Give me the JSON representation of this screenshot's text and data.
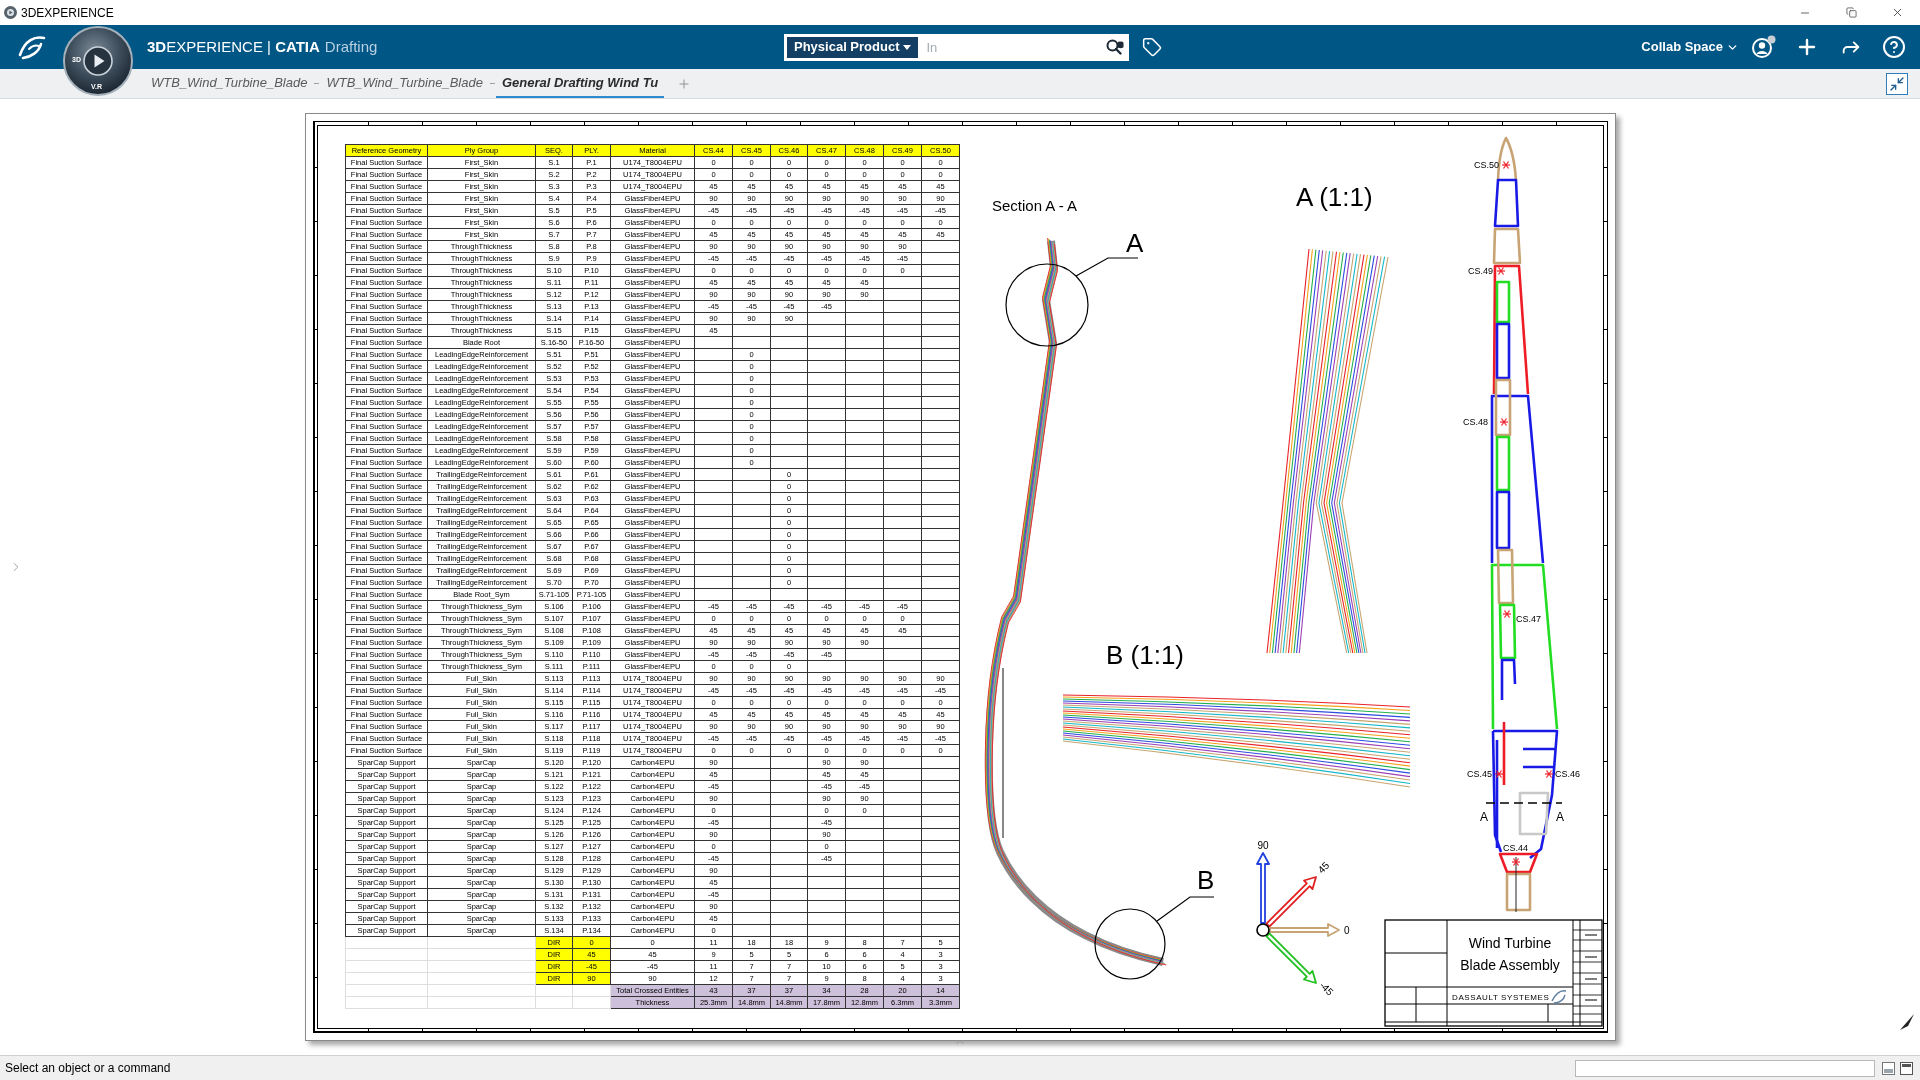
{
  "title_bar": {
    "title": "3DEXPERIENCE"
  },
  "top_bar": {
    "brand": "**3D**EXPERIENCE | **CATIA**",
    "module": "Drafting",
    "compass_labels": [
      "3D",
      "V.R"
    ],
    "search": {
      "scope": "Physical Product",
      "placeholder": "In"
    },
    "space": "Collab Space"
  },
  "tabs": [
    {
      "label": "WTB_Wind_Turbine_Blade",
      "selected": false
    },
    {
      "label": "WTB_Wind_Turbine_Blade",
      "selected": false
    },
    {
      "label": "General Drafting Wind Tu",
      "selected": true
    }
  ],
  "sheet": {
    "table": {
      "columns": [
        "Reference Geometry",
        "Ply Group",
        "SEQ.",
        "PLY.",
        "Material",
        "CS.44",
        "CS.45",
        "CS.46",
        "CS.47",
        "CS.48",
        "CS.49",
        "CS.50"
      ],
      "rows": [
        [
          "Final Suction Surface",
          "First_Skin",
          "S.1",
          "P.1",
          "U174_T8004EPU",
          "0",
          "0",
          "0",
          "0",
          "0",
          "0",
          "0"
        ],
        [
          "Final Suction Surface",
          "First_Skin",
          "S.2",
          "P.2",
          "U174_T8004EPU",
          "0",
          "0",
          "0",
          "0",
          "0",
          "0",
          "0"
        ],
        [
          "Final Suction Surface",
          "First_Skin",
          "S.3",
          "P.3",
          "U174_T8004EPU",
          "45",
          "45",
          "45",
          "45",
          "45",
          "45",
          "45"
        ],
        [
          "Final Suction Surface",
          "First_Skin",
          "S.4",
          "P.4",
          "GlassFiber4EPU",
          "90",
          "90",
          "90",
          "90",
          "90",
          "90",
          "90"
        ],
        [
          "Final Suction Surface",
          "First_Skin",
          "S.5",
          "P.5",
          "GlassFiber4EPU",
          "-45",
          "-45",
          "-45",
          "-45",
          "-45",
          "-45",
          "-45"
        ],
        [
          "Final Suction Surface",
          "First_Skin",
          "S.6",
          "P.6",
          "GlassFiber4EPU",
          "0",
          "0",
          "0",
          "0",
          "0",
          "0",
          "0"
        ],
        [
          "Final Suction Surface",
          "First_Skin",
          "S.7",
          "P.7",
          "GlassFiber4EPU",
          "45",
          "45",
          "45",
          "45",
          "45",
          "45",
          "45"
        ],
        [
          "Final Suction Surface",
          "ThroughThickness",
          "S.8",
          "P.8",
          "GlassFiber4EPU",
          "90",
          "90",
          "90",
          "90",
          "90",
          "90",
          null
        ],
        [
          "Final Suction Surface",
          "ThroughThickness",
          "S.9",
          "P.9",
          "GlassFiber4EPU",
          "-45",
          "-45",
          "-45",
          "-45",
          "-45",
          "-45",
          null
        ],
        [
          "Final Suction Surface",
          "ThroughThickness",
          "S.10",
          "P.10",
          "GlassFiber4EPU",
          "0",
          "0",
          "0",
          "0",
          "0",
          "0",
          null
        ],
        [
          "Final Suction Surface",
          "ThroughThickness",
          "S.11",
          "P.11",
          "GlassFiber4EPU",
          "45",
          "45",
          "45",
          "45",
          "45",
          null,
          null
        ],
        [
          "Final Suction Surface",
          "ThroughThickness",
          "S.12",
          "P.12",
          "GlassFiber4EPU",
          "90",
          "90",
          "90",
          "90",
          "90",
          null,
          null
        ],
        [
          "Final Suction Surface",
          "ThroughThickness",
          "S.13",
          "P.13",
          "GlassFiber4EPU",
          "-45",
          "-45",
          "-45",
          "-45",
          null,
          null,
          null
        ],
        [
          "Final Suction Surface",
          "ThroughThickness",
          "S.14",
          "P.14",
          "GlassFiber4EPU",
          "90",
          "90",
          "90",
          null,
          null,
          null,
          null
        ],
        [
          "Final Suction Surface",
          "ThroughThickness",
          "S.15",
          "P.15",
          "GlassFiber4EPU",
          "45",
          null,
          null,
          null,
          null,
          null,
          null
        ],
        [
          "Final Suction Surface",
          "Blade Root",
          "S.16-50",
          "P.16-50",
          "GlassFiber4EPU",
          null,
          null,
          null,
          null,
          null,
          null,
          null
        ],
        [
          "Final Suction Surface",
          "LeadingEdgeReinforcement",
          "S.51",
          "P.51",
          "GlassFiber4EPU",
          null,
          "0",
          null,
          null,
          null,
          null,
          null
        ],
        [
          "Final Suction Surface",
          "LeadingEdgeReinforcement",
          "S.52",
          "P.52",
          "GlassFiber4EPU",
          null,
          "0",
          null,
          null,
          null,
          null,
          null
        ],
        [
          "Final Suction Surface",
          "LeadingEdgeReinforcement",
          "S.53",
          "P.53",
          "GlassFiber4EPU",
          null,
          "0",
          null,
          null,
          null,
          null,
          null
        ],
        [
          "Final Suction Surface",
          "LeadingEdgeReinforcement",
          "S.54",
          "P.54",
          "GlassFiber4EPU",
          null,
          "0",
          null,
          null,
          null,
          null,
          null
        ],
        [
          "Final Suction Surface",
          "LeadingEdgeReinforcement",
          "S.55",
          "P.55",
          "GlassFiber4EPU",
          null,
          "0",
          null,
          null,
          null,
          null,
          null
        ],
        [
          "Final Suction Surface",
          "LeadingEdgeReinforcement",
          "S.56",
          "P.56",
          "GlassFiber4EPU",
          null,
          "0",
          null,
          null,
          null,
          null,
          null
        ],
        [
          "Final Suction Surface",
          "LeadingEdgeReinforcement",
          "S.57",
          "P.57",
          "GlassFiber4EPU",
          null,
          "0",
          null,
          null,
          null,
          null,
          null
        ],
        [
          "Final Suction Surface",
          "LeadingEdgeReinforcement",
          "S.58",
          "P.58",
          "GlassFiber4EPU",
          null,
          "0",
          null,
          null,
          null,
          null,
          null
        ],
        [
          "Final Suction Surface",
          "LeadingEdgeReinforcement",
          "S.59",
          "P.59",
          "GlassFiber4EPU",
          null,
          "0",
          null,
          null,
          null,
          null,
          null
        ],
        [
          "Final Suction Surface",
          "LeadingEdgeReinforcement",
          "S.60",
          "P.60",
          "GlassFiber4EPU",
          null,
          "0",
          null,
          null,
          null,
          null,
          null
        ],
        [
          "Final Suction Surface",
          "TrailingEdgeReinforcement",
          "S.61",
          "P.61",
          "GlassFiber4EPU",
          null,
          null,
          "0",
          null,
          null,
          null,
          null
        ],
        [
          "Final Suction Surface",
          "TrailingEdgeReinforcement",
          "S.62",
          "P.62",
          "GlassFiber4EPU",
          null,
          null,
          "0",
          null,
          null,
          null,
          null
        ],
        [
          "Final Suction Surface",
          "TrailingEdgeReinforcement",
          "S.63",
          "P.63",
          "GlassFiber4EPU",
          null,
          null,
          "0",
          null,
          null,
          null,
          null
        ],
        [
          "Final Suction Surface",
          "TrailingEdgeReinforcement",
          "S.64",
          "P.64",
          "GlassFiber4EPU",
          null,
          null,
          "0",
          null,
          null,
          null,
          null
        ],
        [
          "Final Suction Surface",
          "TrailingEdgeReinforcement",
          "S.65",
          "P.65",
          "GlassFiber4EPU",
          null,
          null,
          "0",
          null,
          null,
          null,
          null
        ],
        [
          "Final Suction Surface",
          "TrailingEdgeReinforcement",
          "S.66",
          "P.66",
          "GlassFiber4EPU",
          null,
          null,
          "0",
          null,
          null,
          null,
          null
        ],
        [
          "Final Suction Surface",
          "TrailingEdgeReinforcement",
          "S.67",
          "P.67",
          "GlassFiber4EPU",
          null,
          null,
          "0",
          null,
          null,
          null,
          null
        ],
        [
          "Final Suction Surface",
          "TrailingEdgeReinforcement",
          "S.68",
          "P.68",
          "GlassFiber4EPU",
          null,
          null,
          "0",
          null,
          null,
          null,
          null
        ],
        [
          "Final Suction Surface",
          "TrailingEdgeReinforcement",
          "S.69",
          "P.69",
          "GlassFiber4EPU",
          null,
          null,
          "0",
          null,
          null,
          null,
          null
        ],
        [
          "Final Suction Surface",
          "TrailingEdgeReinforcement",
          "S.70",
          "P.70",
          "GlassFiber4EPU",
          null,
          null,
          "0",
          null,
          null,
          null,
          null
        ],
        [
          "Final Suction Surface",
          "Blade Root_Sym",
          "S.71-105",
          "P.71-105",
          "GlassFiber4EPU",
          null,
          null,
          null,
          null,
          null,
          null,
          null
        ],
        [
          "Final Suction Surface",
          "ThroughThickness_Sym",
          "S.106",
          "P.106",
          "GlassFiber4EPU",
          "-45",
          "-45",
          "-45",
          "-45",
          "-45",
          "-45",
          null
        ],
        [
          "Final Suction Surface",
          "ThroughThickness_Sym",
          "S.107",
          "P.107",
          "GlassFiber4EPU",
          "0",
          "0",
          "0",
          "0",
          "0",
          "0",
          null
        ],
        [
          "Final Suction Surface",
          "ThroughThickness_Sym",
          "S.108",
          "P.108",
          "GlassFiber4EPU",
          "45",
          "45",
          "45",
          "45",
          "45",
          "45",
          null
        ],
        [
          "Final Suction Surface",
          "ThroughThickness_Sym",
          "S.109",
          "P.109",
          "GlassFiber4EPU",
          "90",
          "90",
          "90",
          "90",
          "90",
          null,
          null
        ],
        [
          "Final Suction Surface",
          "ThroughThickness_Sym",
          "S.110",
          "P.110",
          "GlassFiber4EPU",
          "-45",
          "-45",
          "-45",
          "-45",
          null,
          null,
          null
        ],
        [
          "Final Suction Surface",
          "ThroughThickness_Sym",
          "S.111",
          "P.111",
          "GlassFiber4EPU",
          "0",
          "0",
          "0",
          null,
          null,
          null,
          null
        ],
        [
          "Final Suction Surface",
          "Full_Skin",
          "S.113",
          "P.113",
          "U174_T8004EPU",
          "90",
          "90",
          "90",
          "90",
          "90",
          "90",
          "90"
        ],
        [
          "Final Suction Surface",
          "Full_Skin",
          "S.114",
          "P.114",
          "U174_T8004EPU",
          "-45",
          "-45",
          "-45",
          "-45",
          "-45",
          "-45",
          "-45"
        ],
        [
          "Final Suction Surface",
          "Full_Skin",
          "S.115",
          "P.115",
          "U174_T8004EPU",
          "0",
          "0",
          "0",
          "0",
          "0",
          "0",
          "0"
        ],
        [
          "Final Suction Surface",
          "Full_Skin",
          "S.116",
          "P.116",
          "U174_T8004EPU",
          "45",
          "45",
          "45",
          "45",
          "45",
          "45",
          "45"
        ],
        [
          "Final Suction Surface",
          "Full_Skin",
          "S.117",
          "P.117",
          "U174_T8004EPU",
          "90",
          "90",
          "90",
          "90",
          "90",
          "90",
          "90"
        ],
        [
          "Final Suction Surface",
          "Full_Skin",
          "S.118",
          "P.118",
          "U174_T8004EPU",
          "-45",
          "-45",
          "-45",
          "-45",
          "-45",
          "-45",
          "-45"
        ],
        [
          "Final Suction Surface",
          "Full_Skin",
          "S.119",
          "P.119",
          "U174_T8004EPU",
          "0",
          "0",
          "0",
          "0",
          "0",
          "0",
          "0"
        ],
        [
          "SparCap Support",
          "SparCap",
          "S.120",
          "P.120",
          "Carbon4EPU",
          "90",
          null,
          null,
          "90",
          "90",
          null,
          null
        ],
        [
          "SparCap Support",
          "SparCap",
          "S.121",
          "P.121",
          "Carbon4EPU",
          "45",
          null,
          null,
          "45",
          "45",
          null,
          null
        ],
        [
          "SparCap Support",
          "SparCap",
          "S.122",
          "P.122",
          "Carbon4EPU",
          "-45",
          null,
          null,
          "-45",
          "-45",
          null,
          null
        ],
        [
          "SparCap Support",
          "SparCap",
          "S.123",
          "P.123",
          "Carbon4EPU",
          "90",
          null,
          null,
          "90",
          "90",
          null,
          null
        ],
        [
          "SparCap Support",
          "SparCap",
          "S.124",
          "P.124",
          "Carbon4EPU",
          "0",
          null,
          null,
          "0",
          "0",
          null,
          null
        ],
        [
          "SparCap Support",
          "SparCap",
          "S.125",
          "P.125",
          "Carbon4EPU",
          "-45",
          null,
          null,
          "-45",
          null,
          null,
          null
        ],
        [
          "SparCap Support",
          "SparCap",
          "S.126",
          "P.126",
          "Carbon4EPU",
          "90",
          null,
          null,
          "90",
          null,
          null,
          null
        ],
        [
          "SparCap Support",
          "SparCap",
          "S.127",
          "P.127",
          "Carbon4EPU",
          "0",
          null,
          null,
          "0",
          null,
          null,
          null
        ],
        [
          "SparCap Support",
          "SparCap",
          "S.128",
          "P.128",
          "Carbon4EPU",
          "-45",
          null,
          null,
          "-45",
          null,
          null,
          null
        ],
        [
          "SparCap Support",
          "SparCap",
          "S.129",
          "P.129",
          "Carbon4EPU",
          "90",
          null,
          null,
          null,
          null,
          null,
          null
        ],
        [
          "SparCap Support",
          "SparCap",
          "S.130",
          "P.130",
          "Carbon4EPU",
          "45",
          null,
          null,
          null,
          null,
          null,
          null
        ],
        [
          "SparCap Support",
          "SparCap",
          "S.131",
          "P.131",
          "Carbon4EPU",
          "-45",
          null,
          null,
          null,
          null,
          null,
          null
        ],
        [
          "SparCap Support",
          "SparCap",
          "S.132",
          "P.132",
          "Carbon4EPU",
          "90",
          null,
          null,
          null,
          null,
          null,
          null
        ],
        [
          "SparCap Support",
          "SparCap",
          "S.133",
          "P.133",
          "Carbon4EPU",
          "45",
          null,
          null,
          null,
          null,
          null,
          null
        ],
        [
          "SparCap Support",
          "SparCap",
          "S.134",
          "P.134",
          "Carbon4EPU",
          "0",
          null,
          null,
          null,
          null,
          null,
          null
        ]
      ],
      "direction_rows": [
        [
          "DIR",
          "0",
          "0",
          "11",
          "18",
          "18",
          "9",
          "8",
          "7",
          "5"
        ],
        [
          "DIR",
          "45",
          "45",
          "9",
          "5",
          "5",
          "6",
          "6",
          "4",
          "3"
        ],
        [
          "DIR",
          "-45",
          "-45",
          "11",
          "7",
          "7",
          "10",
          "6",
          "5",
          "3"
        ],
        [
          "DIR",
          "90",
          "90",
          "12",
          "7",
          "7",
          "9",
          "8",
          "4",
          "3"
        ]
      ],
      "summary_rows": [
        [
          "Total Crossed Entities",
          "43",
          "37",
          "37",
          "34",
          "28",
          "20",
          "14"
        ],
        [
          "Thickness",
          "25.3mm",
          "14.8mm",
          "14.8mm",
          "17.8mm",
          "12.8mm",
          "6.3mm",
          "3.3mm"
        ]
      ]
    },
    "section_view": {
      "title": "Section A - A",
      "callouts": [
        "A",
        "B"
      ]
    },
    "detail_views": [
      {
        "title": "A (1:1)"
      },
      {
        "title": "B (1:1)"
      }
    ],
    "axis_labels": [
      "90",
      "45",
      "0",
      "-45"
    ],
    "planform": {
      "section_labels": [
        "CS.50",
        "CS.49",
        "CS.48",
        "CS.47",
        "CS.45",
        "CS.46",
        "CS.44"
      ],
      "cut_labels": [
        "A",
        "A"
      ]
    },
    "title_block": {
      "title_lines": [
        "Wind Turbine",
        "Blade Assembly"
      ],
      "company": "DASSAULT SYSTEMES"
    }
  },
  "status_bar": {
    "message": "Select an object or a command"
  }
}
